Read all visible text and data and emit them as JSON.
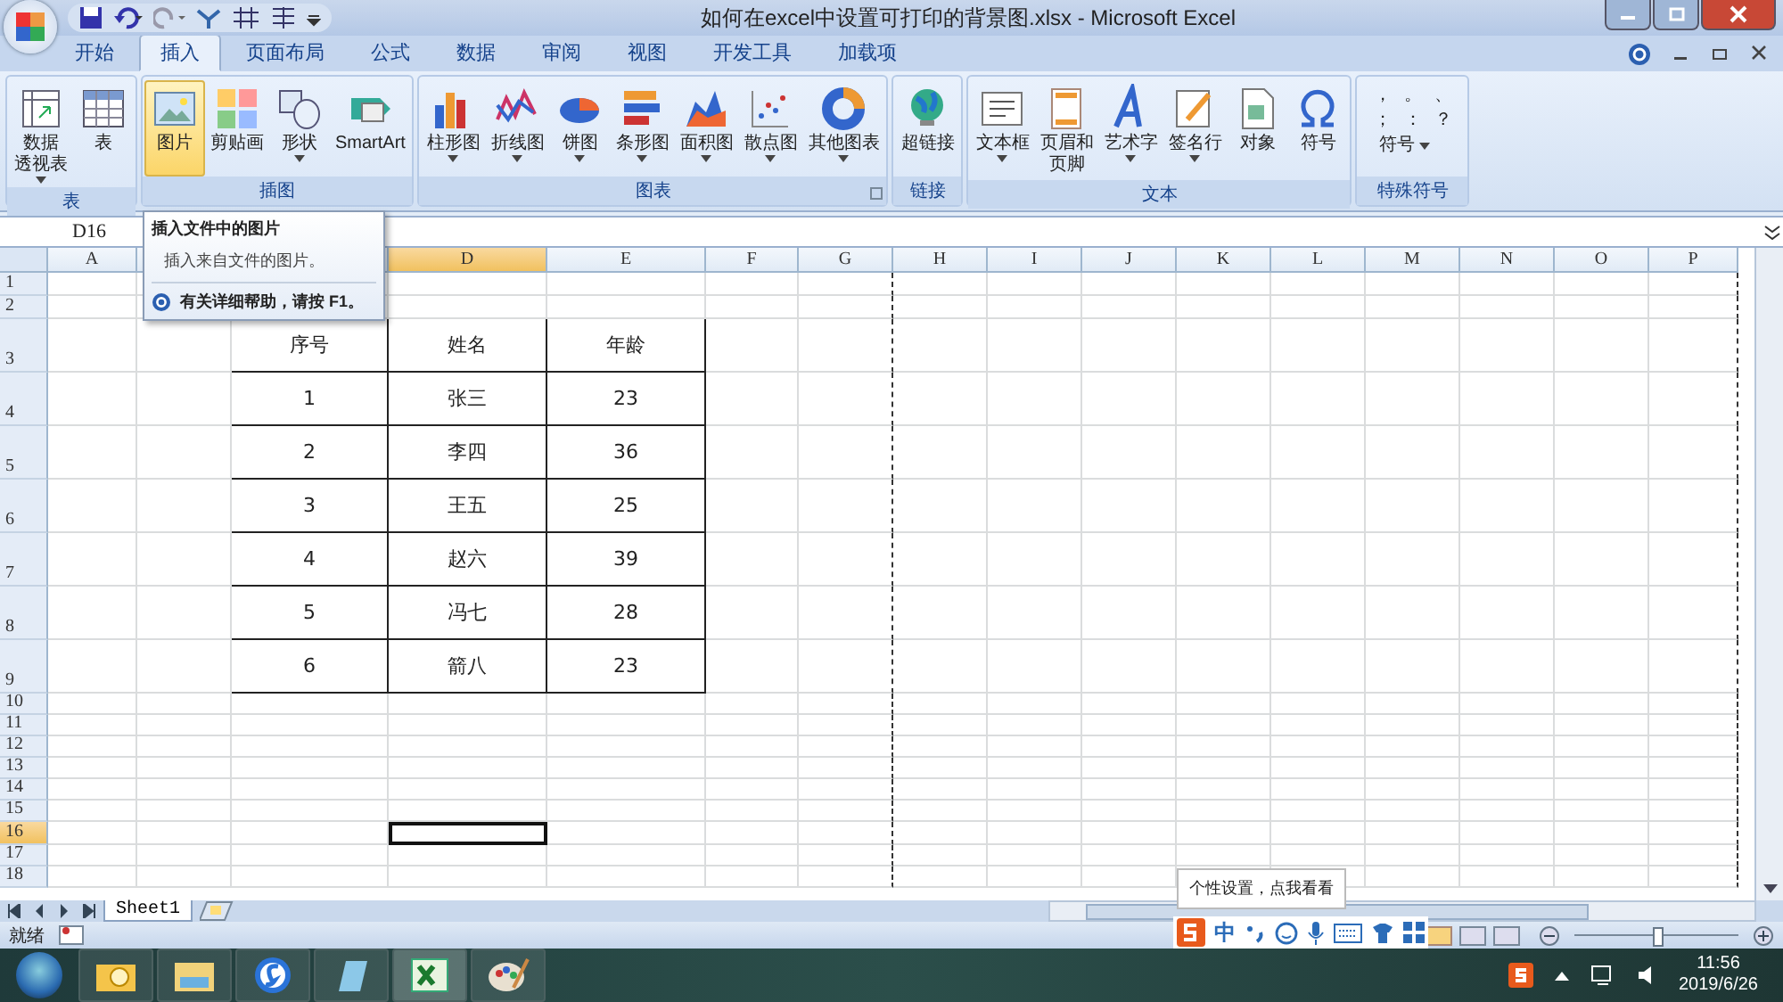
{
  "window": {
    "title": "如何在excel中设置可打印的背景图.xlsx - Microsoft Excel"
  },
  "tabs": [
    {
      "label": "开始",
      "selected": false
    },
    {
      "label": "插入",
      "selected": true
    },
    {
      "label": "页面布局",
      "selected": false
    },
    {
      "label": "公式",
      "selected": false
    },
    {
      "label": "数据",
      "selected": false
    },
    {
      "label": "审阅",
      "selected": false
    },
    {
      "label": "视图",
      "selected": false
    },
    {
      "label": "开发工具",
      "selected": false
    },
    {
      "label": "加载项",
      "selected": false
    }
  ],
  "ribbon_groups": [
    {
      "label": "表",
      "buttons": [
        {
          "lines": [
            "数据",
            "透视表"
          ],
          "dropdown": true,
          "highlighted": false
        },
        {
          "lines": [
            "表"
          ],
          "dropdown": false,
          "highlighted": false
        }
      ]
    },
    {
      "label": "插图",
      "buttons": [
        {
          "lines": [
            "图片"
          ],
          "dropdown": false,
          "highlighted": true
        },
        {
          "lines": [
            "剪贴画"
          ],
          "dropdown": false,
          "highlighted": false
        },
        {
          "lines": [
            "形状"
          ],
          "dropdown": true,
          "highlighted": false
        },
        {
          "lines": [
            "SmartArt"
          ],
          "dropdown": false,
          "highlighted": false
        }
      ]
    },
    {
      "label": "图表",
      "buttons": [
        {
          "lines": [
            "柱形图"
          ],
          "dropdown": true,
          "highlighted": false
        },
        {
          "lines": [
            "折线图"
          ],
          "dropdown": true,
          "highlighted": false
        },
        {
          "lines": [
            "饼图"
          ],
          "dropdown": true,
          "highlighted": false
        },
        {
          "lines": [
            "条形图"
          ],
          "dropdown": true,
          "highlighted": false
        },
        {
          "lines": [
            "面积图"
          ],
          "dropdown": true,
          "highlighted": false
        },
        {
          "lines": [
            "散点图"
          ],
          "dropdown": true,
          "highlighted": false
        },
        {
          "lines": [
            "其他图表"
          ],
          "dropdown": true,
          "highlighted": false
        }
      ]
    },
    {
      "label": "链接",
      "buttons": [
        {
          "lines": [
            "超链接"
          ],
          "dropdown": false,
          "highlighted": false
        }
      ]
    },
    {
      "label": "文本",
      "buttons": [
        {
          "lines": [
            "文本框"
          ],
          "dropdown": true,
          "highlighted": false
        },
        {
          "lines": [
            "页眉和",
            "页脚"
          ],
          "dropdown": false,
          "highlighted": false
        },
        {
          "lines": [
            "艺术字"
          ],
          "dropdown": true,
          "highlighted": false
        },
        {
          "lines": [
            "签名行"
          ],
          "dropdown": true,
          "highlighted": false
        },
        {
          "lines": [
            "对象"
          ],
          "dropdown": false,
          "highlighted": false
        },
        {
          "lines": [
            "符号"
          ],
          "dropdown": false,
          "highlighted": false
        }
      ]
    }
  ],
  "special_symbols": {
    "label": "特殊符号",
    "symbols": [
      "，",
      "。",
      "、",
      "；",
      "：",
      "？"
    ],
    "button": "符号"
  },
  "name_box": "D16",
  "columns": [
    {
      "label": "A",
      "selected": false
    },
    {
      "selected": false
    },
    {
      "selected": false
    },
    {
      "label": "D",
      "selected": true
    },
    {
      "label": "E",
      "selected": false
    },
    {
      "label": "F",
      "selected": false
    },
    {
      "label": "G",
      "selected": false
    },
    {
      "label": "H",
      "selected": false
    },
    {
      "label": "I",
      "selected": false
    },
    {
      "label": "J",
      "selected": false
    },
    {
      "label": "K",
      "selected": false
    },
    {
      "label": "L",
      "selected": false
    },
    {
      "label": "M",
      "selected": false
    },
    {
      "label": "N",
      "selected": false
    },
    {
      "label": "O",
      "selected": false
    },
    {
      "label": "P",
      "selected": false
    }
  ],
  "rows": [
    {
      "label": "1",
      "selected": false
    },
    {
      "label": "2",
      "selected": false
    },
    {
      "label": "3",
      "selected": false
    },
    {
      "label": "4",
      "selected": false
    },
    {
      "label": "5",
      "selected": false
    },
    {
      "label": "6",
      "selected": false
    },
    {
      "label": "7",
      "selected": false
    },
    {
      "label": "8",
      "selected": false
    },
    {
      "label": "9",
      "selected": false
    },
    {
      "label": "10",
      "selected": false
    },
    {
      "label": "11",
      "selected": false
    },
    {
      "label": "12",
      "selected": false
    },
    {
      "label": "13",
      "selected": false
    },
    {
      "label": "14",
      "selected": false
    },
    {
      "label": "15",
      "selected": false
    },
    {
      "label": "16",
      "selected": true
    },
    {
      "label": "17",
      "selected": false
    },
    {
      "label": "18",
      "selected": false
    }
  ],
  "table": {
    "header": [
      "序号",
      "姓名",
      "年龄"
    ],
    "rows": [
      [
        "1",
        "张三",
        "23"
      ],
      [
        "2",
        "李四",
        "36"
      ],
      [
        "3",
        "王五",
        "25"
      ],
      [
        "4",
        "赵六",
        "39"
      ],
      [
        "5",
        "冯七",
        "28"
      ],
      [
        "6",
        "箭八",
        "23"
      ]
    ]
  },
  "tooltip": {
    "title": "插入文件中的图片",
    "description": "插入来自文件的图片。",
    "help": "有关详细帮助，请按 F1。"
  },
  "sheet_tabs": [
    {
      "label": "Sheet1",
      "selected": true
    }
  ],
  "status": "就绪",
  "zoom": {
    "level": 0.5
  },
  "ime": {
    "tooltip": "个性设置，点我看看",
    "mode": "中"
  },
  "clock": {
    "time": "11:56",
    "date": "2019/6/26"
  }
}
